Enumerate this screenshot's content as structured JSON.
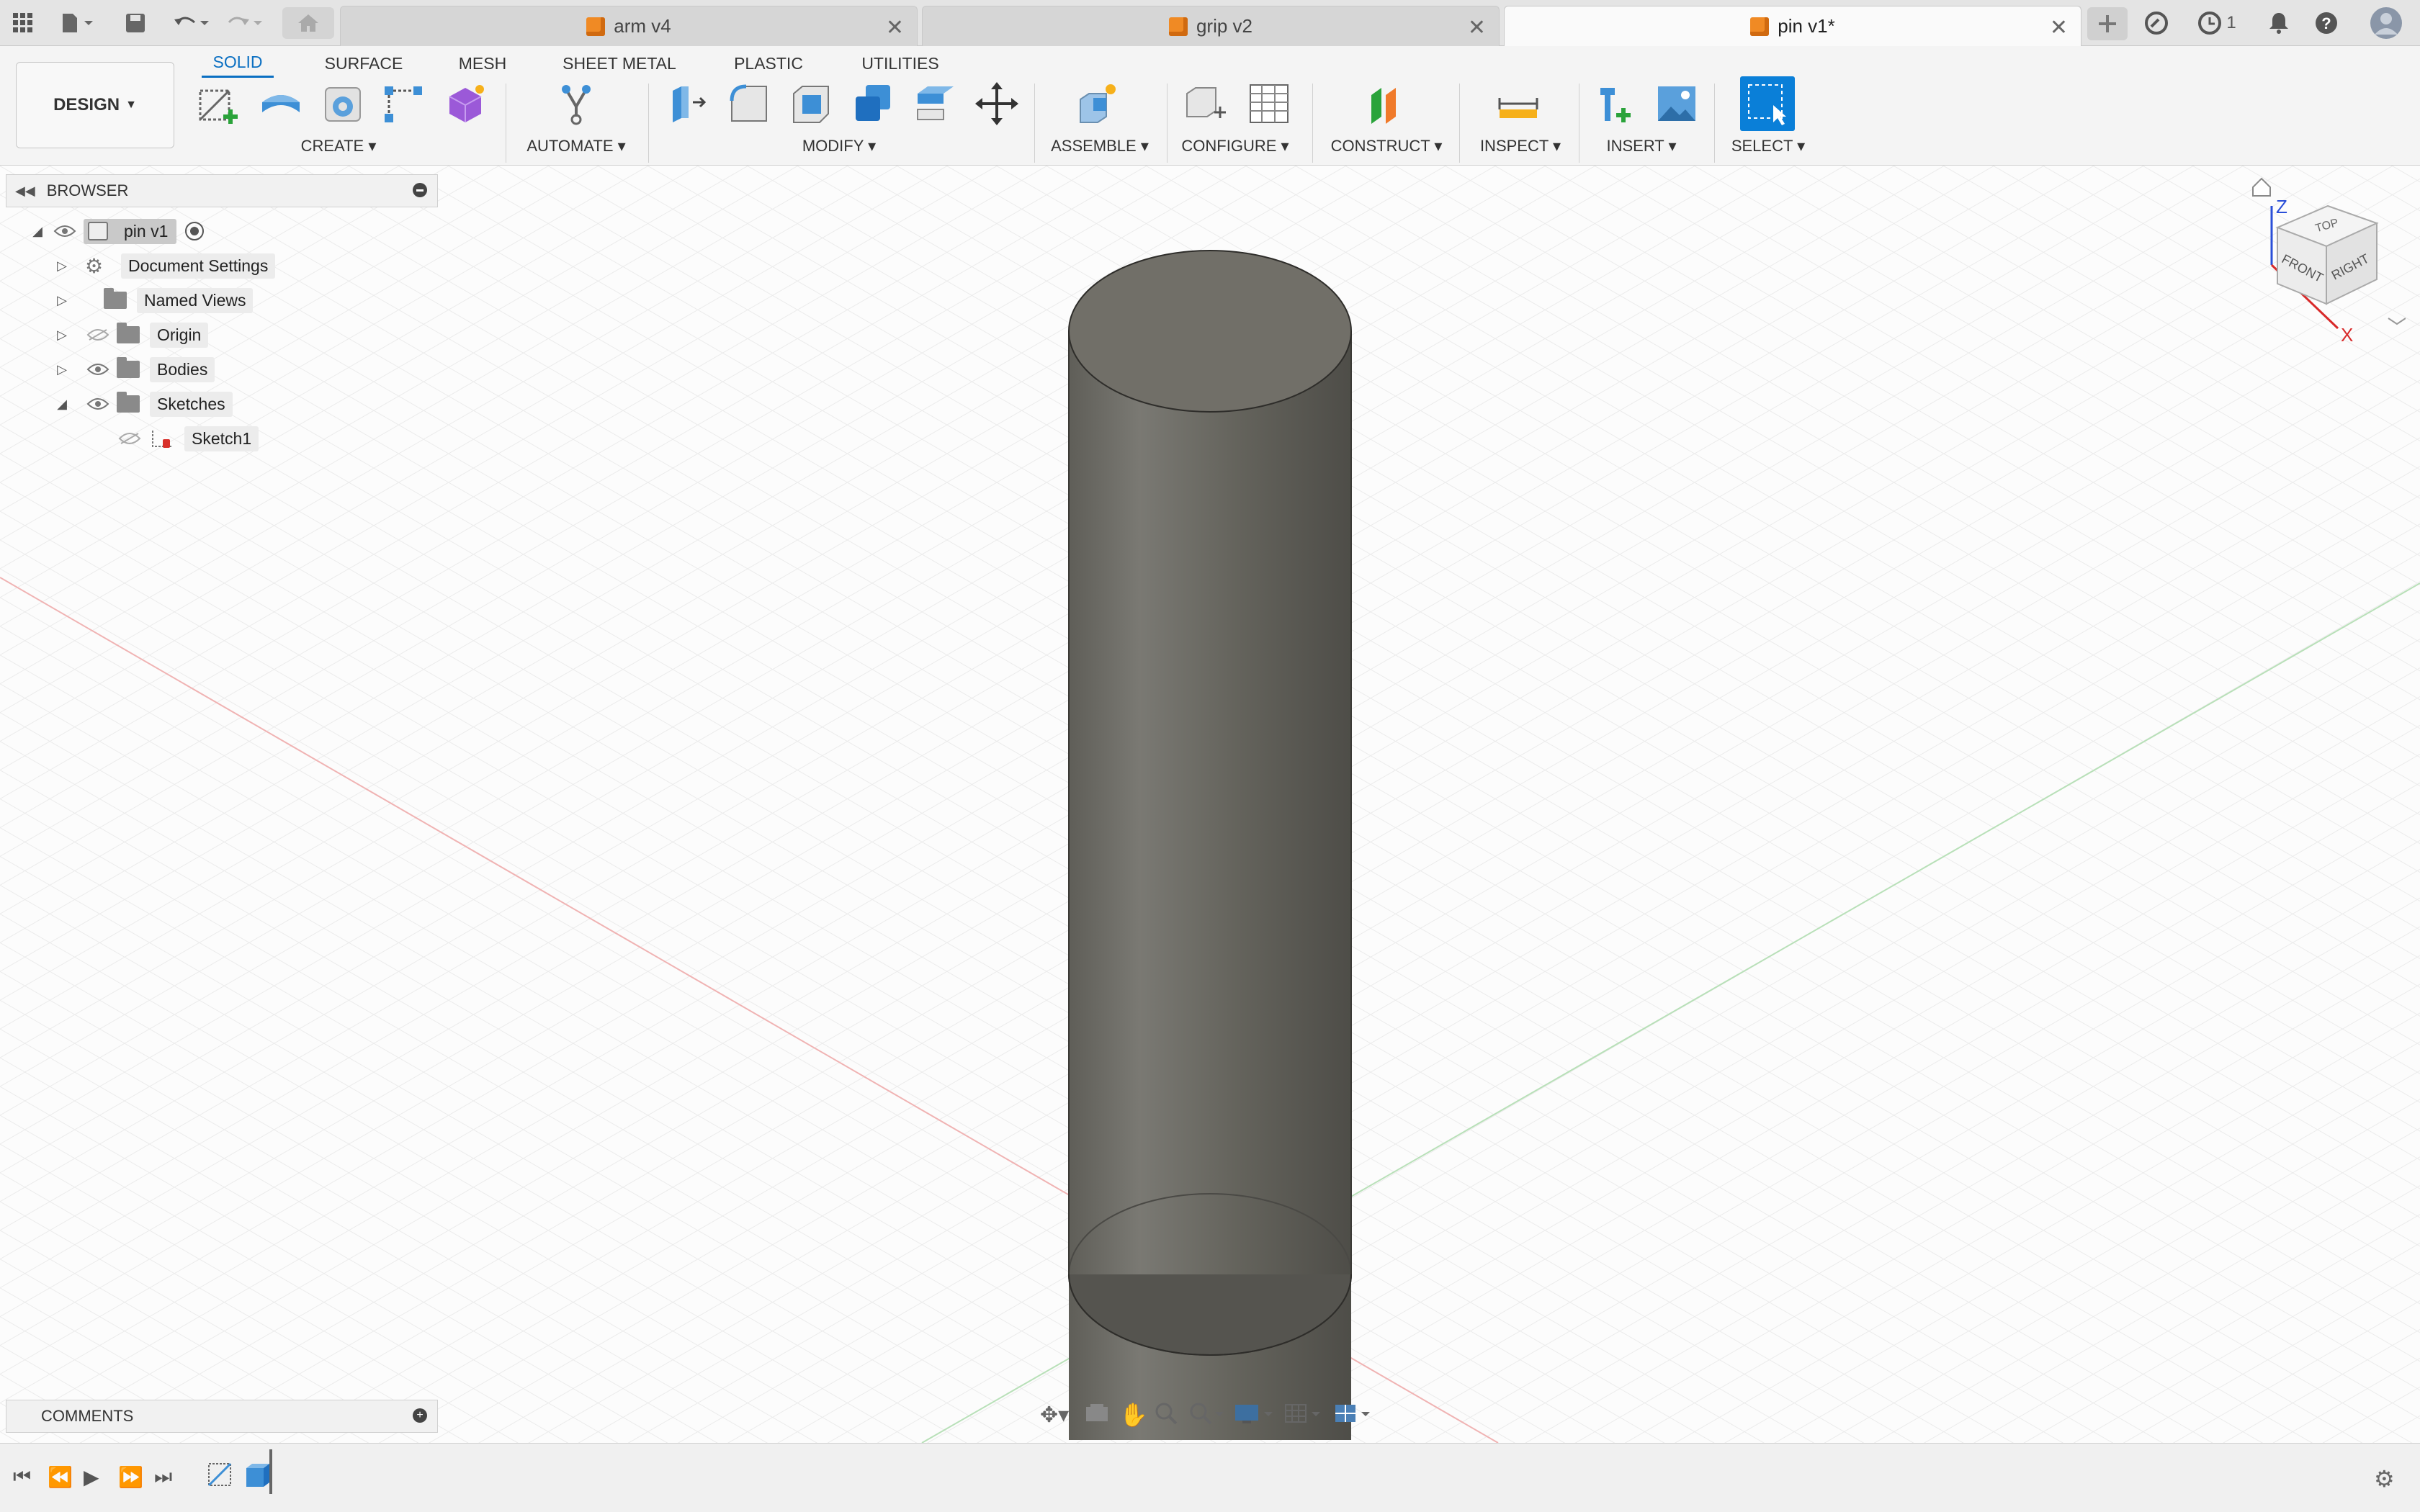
{
  "titlebar": {
    "tabs": [
      {
        "label": "arm v4"
      },
      {
        "label": "grip v2"
      },
      {
        "label": "pin v1*"
      }
    ],
    "job_count": "1"
  },
  "toolbar": {
    "design_label": "DESIGN",
    "workspace_tabs": [
      "SOLID",
      "SURFACE",
      "MESH",
      "SHEET METAL",
      "PLASTIC",
      "UTILITIES"
    ],
    "groups": {
      "create": "CREATE",
      "automate": "AUTOMATE",
      "modify": "MODIFY",
      "assemble": "ASSEMBLE",
      "configure": "CONFIGURE",
      "construct": "CONSTRUCT",
      "inspect": "INSPECT",
      "insert": "INSERT",
      "select": "SELECT"
    }
  },
  "browser": {
    "title": "BROWSER",
    "root": "pin v1",
    "items": [
      {
        "label": "Document Settings"
      },
      {
        "label": "Named Views"
      },
      {
        "label": "Origin"
      },
      {
        "label": "Bodies"
      },
      {
        "label": "Sketches"
      },
      {
        "label": "Sketch1"
      }
    ]
  },
  "comments": {
    "title": "COMMENTS"
  },
  "viewcube": {
    "top": "TOP",
    "front": "FRONT",
    "right": "RIGHT",
    "z": "Z",
    "x": "X"
  },
  "colors": {
    "accent": "#0a6fc2",
    "body": "#6b6a64",
    "grid": "#e6e6e6"
  }
}
